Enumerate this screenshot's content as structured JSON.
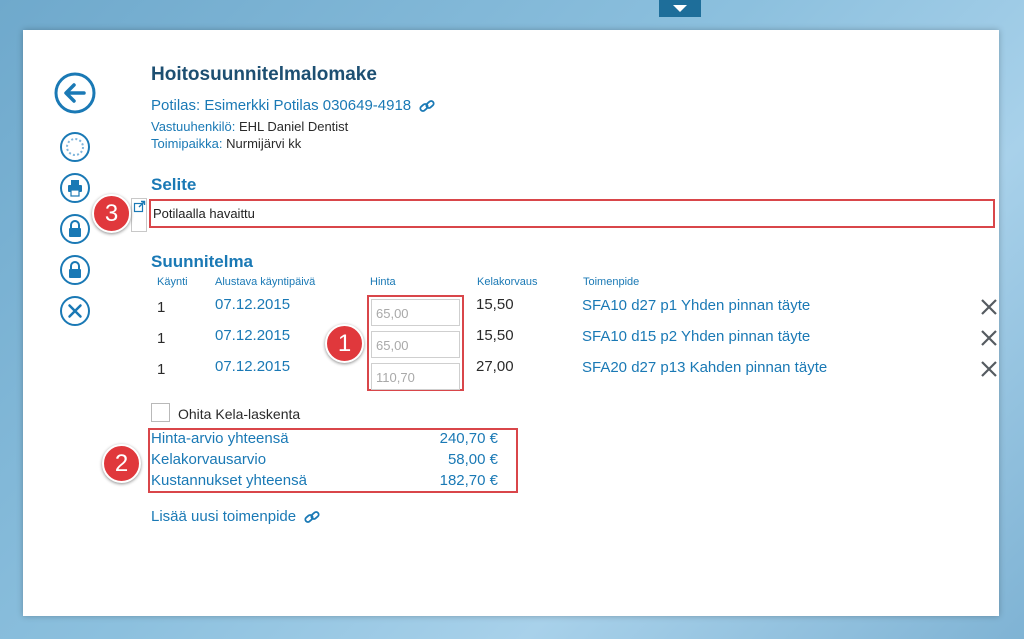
{
  "form": {
    "title": "Hoitosuunnitelmalomake",
    "patient_label": "Potilas:",
    "patient_value": "Esimerkki Potilas 030649-4918",
    "responsible_label": "Vastuuhenkilö:",
    "responsible_value": "EHL Daniel Dentist",
    "location_label": "Toimipaikka:",
    "location_value": "Nurmijärvi kk"
  },
  "selite": {
    "heading": "Selite",
    "value": "Potilaalla havaittu"
  },
  "plan": {
    "heading": "Suunnitelma",
    "columns": {
      "visit": "Käynti",
      "date": "Alustava käyntipäivä",
      "price": "Hinta",
      "kela": "Kelakorvaus",
      "procedure": "Toimenpide"
    },
    "rows": [
      {
        "visit": "1",
        "date": "07.12.2015",
        "price": "65,00",
        "kela": "15,50",
        "procedure": "SFA10 d27 p1 Yhden pinnan täyte"
      },
      {
        "visit": "1",
        "date": "07.12.2015",
        "price": "65,00",
        "kela": "15,50",
        "procedure": "SFA10 d15 p2 Yhden pinnan täyte"
      },
      {
        "visit": "1",
        "date": "07.12.2015",
        "price": "110,70",
        "kela": "27,00",
        "procedure": "SFA20 d27 p13 Kahden pinnan täyte"
      }
    ],
    "skip_kela_label": "Ohita Kela-laskenta",
    "skip_kela_checked": false
  },
  "totals": {
    "estimate_label": "Hinta-arvio yhteensä",
    "estimate_value": "240,70 €",
    "kela_label": "Kelakorvausarvio",
    "kela_value": "58,00 €",
    "cost_label": "Kustannukset yhteensä",
    "cost_value": "182,70 €"
  },
  "add_link": "Lisää uusi toimenpide",
  "callouts": [
    "1",
    "2",
    "3"
  ],
  "sidebar_icons": [
    "back-arrow-icon",
    "loading-spinner-icon",
    "print-icon",
    "lock-icon",
    "lock-icon",
    "close-circle-icon"
  ],
  "colors": {
    "accent": "#1a79b5",
    "title": "#1d4f72",
    "highlight": "#d9464a"
  }
}
